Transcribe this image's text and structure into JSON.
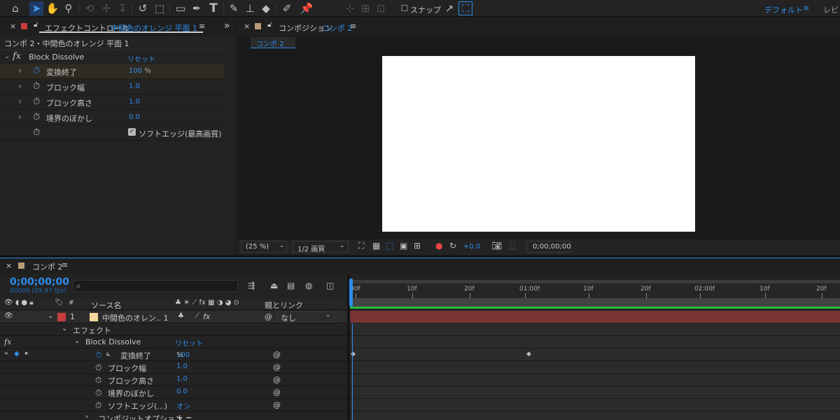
{
  "toolbar": {
    "snap_label": "スナップ",
    "workspace": "デフォルト",
    "workspace_more": "レビ",
    "menu_icon": "≡"
  },
  "effect_panel": {
    "close": "×",
    "title_prefix": "エフェクトコントロール",
    "title_layer": "中間色のオレンジ 平面 1",
    "menu": "≡",
    "expand": "»",
    "breadcrumb": "コンポ 2・中間色のオレンジ 平面 1",
    "fx_label": "fx",
    "effect_name": "Block Dissolve",
    "reset": "リセット",
    "properties": [
      {
        "label": "変換終了",
        "value": "100",
        "unit": "%"
      },
      {
        "label": "ブロック幅",
        "value": "1.0",
        "unit": ""
      },
      {
        "label": "ブロック高さ",
        "value": "1.0",
        "unit": ""
      },
      {
        "label": "境界のぼかし",
        "value": "0.0",
        "unit": ""
      }
    ],
    "soft_edge_label": "ソフトエッジ(最高画質)"
  },
  "comp_panel": {
    "close": "×",
    "title_prefix": "コンポジション",
    "title_comp": "コンポ 2",
    "menu": "≡",
    "comp_tab": "コンポ 2",
    "zoom": "(25 %)",
    "resolution": "1/2 画質",
    "exposure": "+0.0",
    "timecode": "0;00;00;00"
  },
  "timeline": {
    "close": "×",
    "tab": "コンポ 2",
    "menu": "≡",
    "timecode": "0;00;00;00",
    "frame_info": "00000 (29.97 fps)",
    "search_icon": "⌕",
    "col_num": "#",
    "col_source": "ソース名",
    "col_parent": "親とリンク",
    "layer": {
      "index": "1",
      "name": "中間色のオレン.. 1",
      "parent": "なし"
    },
    "effects_group": "エフェクト",
    "fx_label": "fx",
    "effect_name": "Block Dissolve",
    "reset": "リセット",
    "props": [
      {
        "label": "変換終了",
        "value": "100",
        "unit": "%"
      },
      {
        "label": "ブロック幅",
        "value": "1.0",
        "unit": ""
      },
      {
        "label": "ブロック高さ",
        "value": "1.0",
        "unit": ""
      },
      {
        "label": "境界のぼかし",
        "value": "0.0",
        "unit": ""
      },
      {
        "label": "ソフトエッジ(...)",
        "value": "オン",
        "unit": ""
      }
    ],
    "composite_options": "コンポジットオプション",
    "plus_minus": "+ −",
    "ruler": [
      "00f",
      "10f",
      "20f",
      "01:00f",
      "10f",
      "20f",
      "02:00f",
      "10f",
      "20f"
    ]
  },
  "colors": {
    "accent": "#2d8ceb",
    "layer_label": "#c83c3c",
    "layer_swatch": "#f5d79b",
    "track_bar": "#7a3535",
    "work_area": "#2bbf3a"
  }
}
